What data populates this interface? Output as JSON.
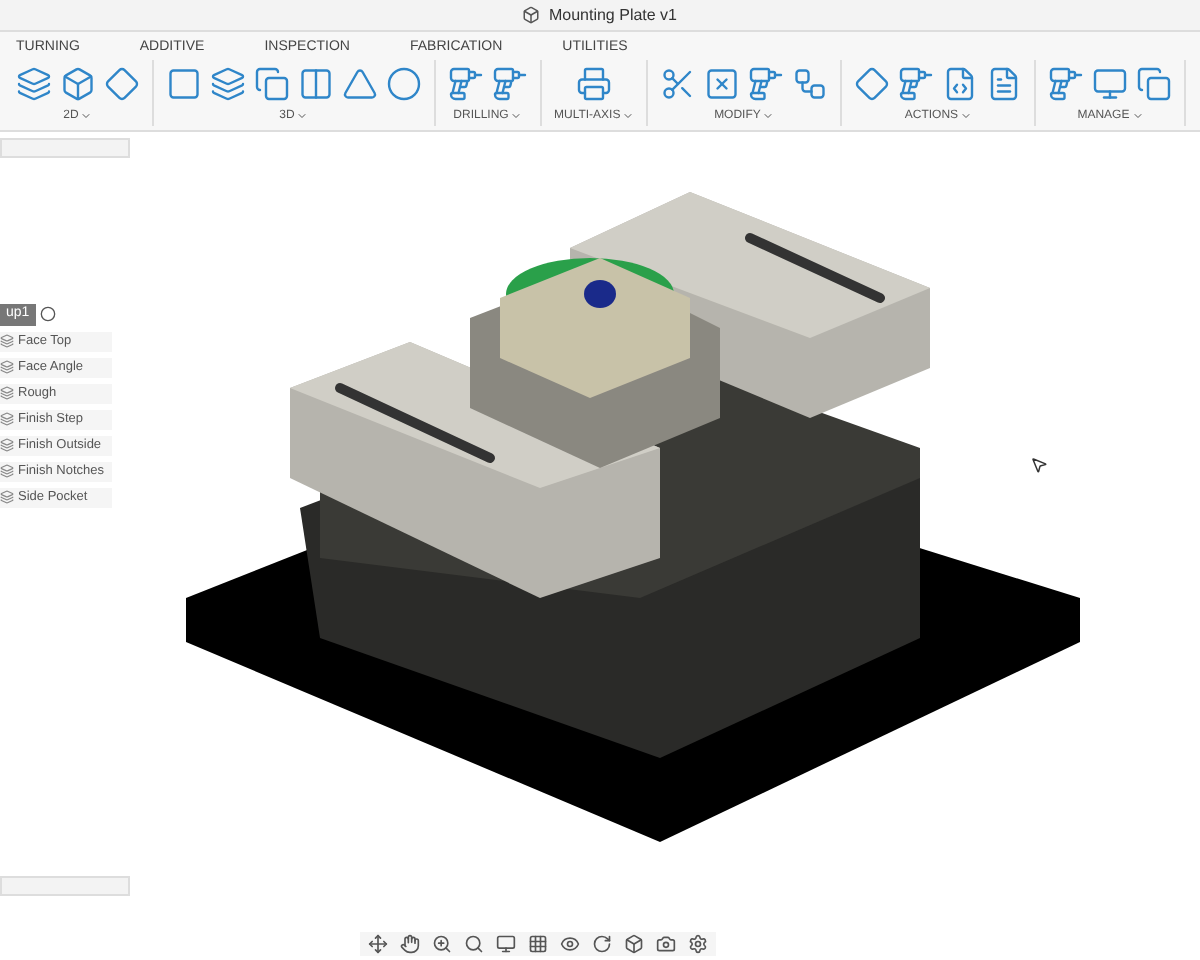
{
  "window": {
    "title": "Mounting Plate v1"
  },
  "tabs": [
    {
      "label": "TURNING"
    },
    {
      "label": "ADDITIVE"
    },
    {
      "label": "INSPECTION"
    },
    {
      "label": "FABRICATION"
    },
    {
      "label": "UTILITIES"
    }
  ],
  "toolbar_groups": [
    {
      "label": "2D"
    },
    {
      "label": "3D"
    },
    {
      "label": "DRILLING"
    },
    {
      "label": "MULTI-AXIS"
    },
    {
      "label": "MODIFY"
    },
    {
      "label": "ACTIONS"
    },
    {
      "label": "MANAGE"
    }
  ],
  "browser": {
    "setup": {
      "label": "up1",
      "selected": true
    },
    "operations": [
      {
        "label": "Face Top"
      },
      {
        "label": "Face Angle"
      },
      {
        "label": "Rough"
      },
      {
        "label": "Finish Step"
      },
      {
        "label": "Finish Outside"
      },
      {
        "label": "Finish Notches"
      },
      {
        "label": "Side Pocket"
      }
    ]
  }
}
